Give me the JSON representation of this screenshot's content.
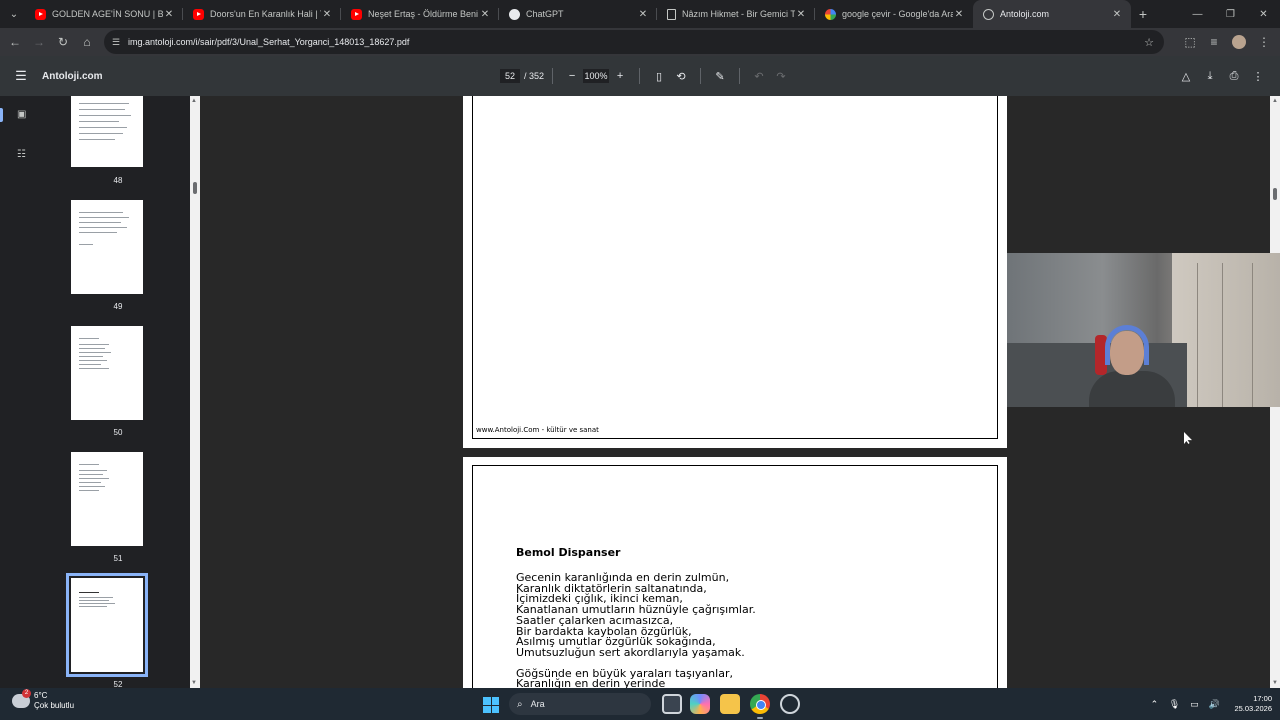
{
  "browser": {
    "tabs": [
      {
        "title": "GOLDEN AGE'İN SONU | Bo",
        "favicon": "youtube-icon"
      },
      {
        "title": "Doors'un En Karanlık Hali | The",
        "favicon": "youtube-icon"
      },
      {
        "title": "Neşet Ertaş - Öldürme Beni",
        "favicon": "youtube-icon"
      },
      {
        "title": "ChatGPT",
        "favicon": "chatgpt-icon"
      },
      {
        "title": "Nâzım Hikmet - Bir Gemici Türk",
        "favicon": "document-icon"
      },
      {
        "title": "google çevir - Google'da Ara",
        "favicon": "google-icon"
      },
      {
        "title": "Antoloji.com",
        "favicon": "globe-icon",
        "active": true
      }
    ],
    "url": "img.antoloji.com/i/sair/pdf/3/Unal_Serhat_Yorganci_148013_18627.pdf"
  },
  "pdf_toolbar": {
    "title": "Antoloji.com",
    "current_page": "52",
    "total_pages": "/ 352",
    "zoom": "100%"
  },
  "thumbnails": [
    {
      "label": "48"
    },
    {
      "label": "49"
    },
    {
      "label": "50"
    },
    {
      "label": "51"
    },
    {
      "label": "52",
      "selected": true
    }
  ],
  "document": {
    "page_footer": "www.Antoloji.Com - kültür ve sanat",
    "poem_title": "Bemol Dispanser",
    "stanza1": [
      "Gecenin karanlığında en derin zulmün,",
      "Karanlık diktatörlerin saltanatında,",
      "İçimizdeki çığlık, ikinci keman,",
      "Kanatlanan umutların hüznüyle çağrışımlar.",
      "Saatler çalarken acımasızca,",
      "Bir bardakta kaybolan özgürlük,",
      "Asılmış umutlar özgürlük sokağında,",
      "Umutsuzluğun sert akordlarıyla yaşamak."
    ],
    "stanza2": [
      "Göğsünde en büyük yaraları taşıyanlar,",
      "Karanlığın en derin yerinde"
    ]
  },
  "taskbar": {
    "weather_temp": "6°C",
    "weather_desc": "Çok bulutlu",
    "weather_badge": "2",
    "search_placeholder": "Ara",
    "time": "17:00",
    "date": "25.03.2026"
  }
}
